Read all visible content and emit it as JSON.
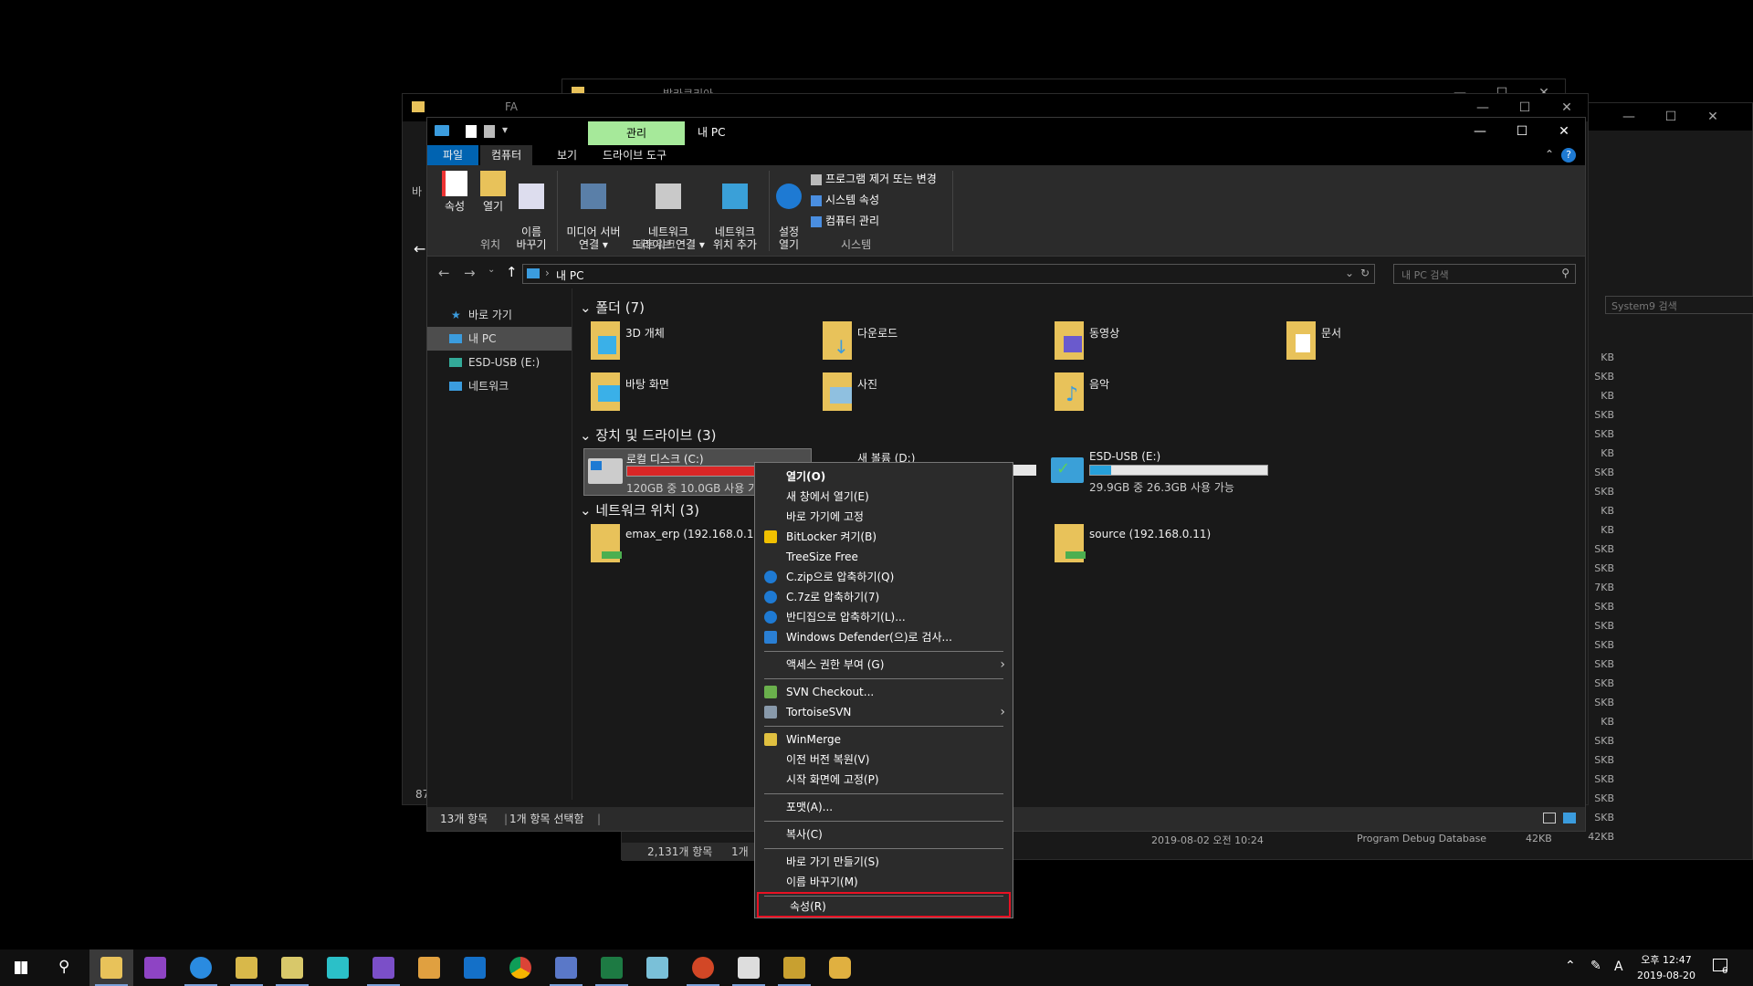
{
  "background_windows": {
    "w1_title": "발카쿠리아",
    "w2_title": "FA",
    "w2_side_label": "바",
    "w2_status": "87",
    "w3_search": "System9 검색",
    "sizes": [
      "KB",
      "SKB",
      "KB",
      "SKB",
      "SKB",
      "KB",
      "SKB",
      "SKB",
      "KB",
      "KB",
      "SKB",
      "SKB",
      "7KB",
      "SKB",
      "SKB",
      "SKB",
      "SKB",
      "SKB",
      "SKB",
      "KB",
      "SKB",
      "SKB",
      "SKB",
      "SKB",
      "SKB",
      "42KB"
    ],
    "file_row": {
      "date": "2019-08-02 오전 10:24",
      "type": "Program Debug Database",
      "size": "42KB"
    },
    "w3_status_count": "2,131개 항목",
    "w3_status_sel": "1개"
  },
  "window": {
    "title": "내 PC",
    "context_tab": "관리",
    "tabs": [
      "파일",
      "컴퓨터",
      "보기",
      "드라이브 도구"
    ]
  },
  "ribbon": {
    "location_group": "위치",
    "network_group": "네트워크",
    "system_group": "시스템",
    "btn_properties": "속성",
    "btn_open": "열기",
    "btn_rename": "이름\n바꾸기",
    "btn_media": "미디어 서버\n연결 ▾",
    "btn_map_drive": "네트워크\n드라이브 연결 ▾",
    "btn_add_netloc": "네트워크\n위치 추가",
    "btn_settings": "설정\n열기",
    "sys_uninstall": "프로그램 제거 또는 변경",
    "sys_props": "시스템 속성",
    "sys_manage": "컴퓨터 관리"
  },
  "address": {
    "path": "내 PC",
    "search_placeholder": "내 PC 검색"
  },
  "nav": {
    "quick": "바로 가기",
    "thispc": "내 PC",
    "usb": "ESD-USB (E:)",
    "network": "네트워크"
  },
  "sections": {
    "folders": "폴더 (7)",
    "devices": "장치 및 드라이브 (3)",
    "netlocs": "네트워크 위치 (3)"
  },
  "folders": [
    "3D 개체",
    "다운로드",
    "동영상",
    "문서",
    "바탕 화면",
    "사진",
    "음악"
  ],
  "drives": {
    "c_name": "로컬 디스크 (C:)",
    "c_info": "120GB 중 10.0GB 사용 가능",
    "c_fill": 0.92,
    "d_name": "새 볼륨 (D:)",
    "e_name": "ESD-USB (E:)",
    "e_info": "29.9GB 중 26.3GB 사용 가능",
    "e_fill": 0.12
  },
  "netlocs": {
    "erp": "emax_erp (192.168.0.11)",
    "source": "source (192.168.0.11)"
  },
  "status": {
    "count": "13개 항목",
    "selected": "1개 항목 선택함"
  },
  "context_menu": {
    "open": "열기(O)",
    "open_new": "새 창에서 열기(E)",
    "pin_quick": "바로 가기에 고정",
    "bitlocker": "BitLocker 켜기(B)",
    "treesize": "TreeSize Free",
    "zip": "C.zip으로 압축하기(Q)",
    "sevenz": "C.7z로 압축하기(7)",
    "bandizip": "반디집으로 압축하기(L)...",
    "defender": "Windows Defender(으)로 검사...",
    "access": "액세스 권한 부여 (G)",
    "svn_checkout": "SVN Checkout...",
    "tortoise": "TortoiseSVN",
    "winmerge": "WinMerge",
    "restore": "이전 버전 복원(V)",
    "pin_start": "시작 화면에 고정(P)",
    "format": "포맷(A)...",
    "copy": "복사(C)",
    "shortcut": "바로 가기 만들기(S)",
    "rename": "이름 바꾸기(M)",
    "properties": "속성(R)"
  },
  "taskbar": {
    "time": "오후 12:47",
    "date": "2019-08-20",
    "ime": "A",
    "notif_count": "6"
  },
  "colors": {
    "accent": "#0063b1",
    "context_tab": "#a6e99a",
    "drive_full": "#da2626",
    "drive_ok": "#26a0da",
    "highlight": "#e81123"
  }
}
